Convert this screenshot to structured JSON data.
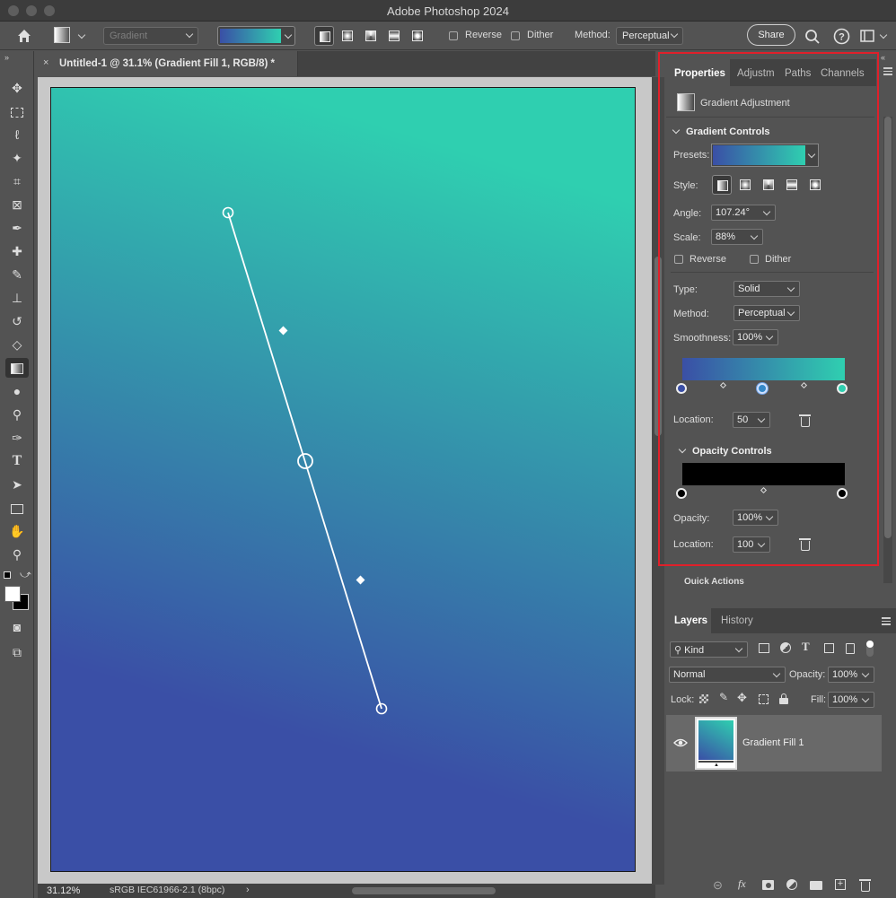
{
  "window": {
    "title": "Adobe Photoshop 2024"
  },
  "options_bar": {
    "preset_placeholder": "Gradient",
    "reverse_label": "Reverse",
    "dither_label": "Dither",
    "method_label": "Method:",
    "method_value": "Perceptual",
    "share_label": "Share"
  },
  "document": {
    "tab_title": "Untitled-1 @ 31.1% (Gradient Fill 1, RGB/8) *",
    "zoom": "31.12%",
    "color_profile": "sRGB IEC61966-2.1 (8bpc)",
    "gradient_colors": {
      "start": "#3a4fa6",
      "end": "#2fcfb0"
    }
  },
  "properties": {
    "tabs": [
      "Properties",
      "Adjustm",
      "Paths",
      "Channels"
    ],
    "header": "Gradient Adjustment",
    "gradient_controls": {
      "title": "Gradient Controls",
      "presets_label": "Presets:",
      "style_label": "Style:",
      "angle_label": "Angle:",
      "angle_value": "107.24°",
      "scale_label": "Scale:",
      "scale_value": "88%",
      "reverse_label": "Reverse",
      "dither_label": "Dither",
      "type_label": "Type:",
      "type_value": "Solid",
      "method_label": "Method:",
      "method_value": "Perceptual",
      "smoothness_label": "Smoothness:",
      "smoothness_value": "100%",
      "location_label": "Location:",
      "location_value": "50"
    },
    "opacity_controls": {
      "title": "Opacity Controls",
      "opacity_label": "Opacity:",
      "opacity_value": "100%",
      "location_label": "Location:",
      "location_value": "100"
    },
    "quick_actions": "Quick Actions"
  },
  "layers": {
    "tabs": [
      "Layers",
      "History"
    ],
    "filter_label": "Kind",
    "blend_mode": "Normal",
    "opacity_label": "Opacity:",
    "opacity_value": "100%",
    "lock_label": "Lock:",
    "fill_label": "Fill:",
    "fill_value": "100%",
    "layer_name": "Gradient Fill 1"
  },
  "colors": {
    "highlight": "#e0202a"
  }
}
